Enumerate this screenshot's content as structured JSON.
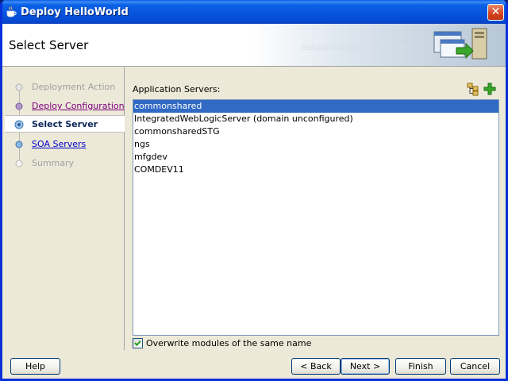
{
  "window": {
    "title": "Deploy HelloWorld",
    "close_glyph": "✕",
    "accent": "#0831d9"
  },
  "header": {
    "title": "Select Server",
    "binary_text": "0101010101010101010101010101"
  },
  "nav": {
    "items": [
      {
        "label": "Deployment Action",
        "state": "disabled"
      },
      {
        "label": "Deploy Configuration",
        "state": "visited"
      },
      {
        "label": "Select Server",
        "state": "current"
      },
      {
        "label": "SOA Servers",
        "state": "link"
      },
      {
        "label": "Summary",
        "state": "disabled"
      }
    ]
  },
  "main": {
    "list_label": "Application Servers:",
    "servers": [
      "commonshared",
      "IntegratedWebLogicServer (domain unconfigured)",
      "commonsharedSTG",
      "ngs",
      "mfgdev",
      "COMDEV11"
    ],
    "selected_index": 0,
    "overwrite_label": "Overwrite modules of the same name",
    "overwrite_checked": true,
    "selection_color": "#316ac5"
  },
  "buttons": {
    "help": "Help",
    "back": "< Back",
    "next": "Next >",
    "finish": "Finish",
    "cancel": "Cancel"
  }
}
